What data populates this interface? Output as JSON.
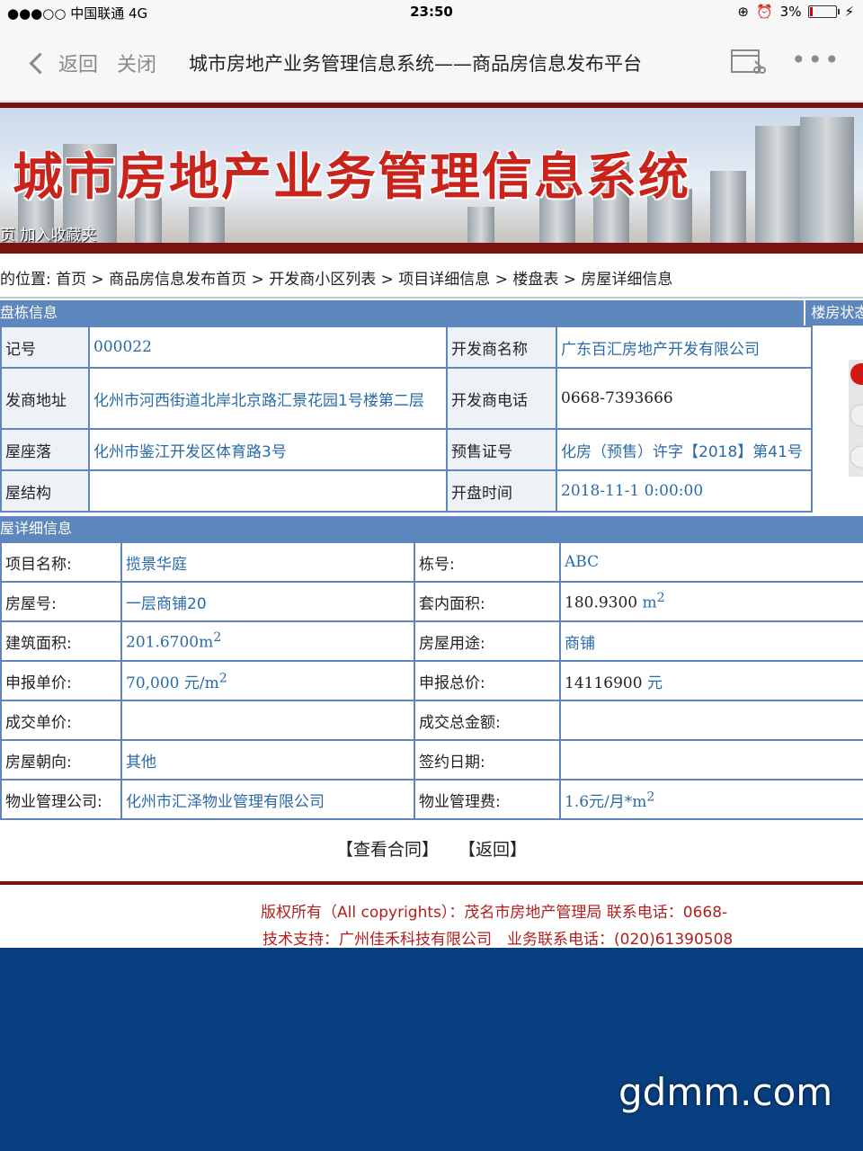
{
  "status": {
    "carrier": "●●●○○ 中国联通  4G",
    "time": "23:50",
    "battery": "3%"
  },
  "nav": {
    "back": "返回",
    "close": "关闭",
    "title": "城市房地产业务管理信息系统——商品房信息发布平台"
  },
  "banner": {
    "title": "城市房地产业务管理信息系统",
    "links": "页 加入收藏夹"
  },
  "breadcrumb": "的位置: 首页 > 商品房信息发布首页 > 开发商小区列表 > 项目详细信息 > 楼盘表 > 房屋详细信息",
  "building": {
    "header": "盘栋信息",
    "status_header": "楼房状态",
    "rows": [
      {
        "l1": "记号",
        "v1": "000022",
        "l2": "开发商名称",
        "v2": "广东百汇房地产开发有限公司"
      },
      {
        "l1": "发商地址",
        "v1": "化州市河西街道北岸北京路汇景花园1号楼第二层",
        "l2": "开发商电话",
        "v2": "0668-7393666"
      },
      {
        "l1": "屋座落",
        "v1": "化州市鉴江开发区体育路3号",
        "l2": "预售证号",
        "v2": "化房（预售）许字【2018】第41号"
      },
      {
        "l1": "屋结构",
        "v1": "",
        "l2": "开盘时间",
        "v2": "2018-11-1 0:00:00"
      }
    ]
  },
  "house": {
    "header": "屋详细信息",
    "rows": [
      {
        "l1": "项目名称:",
        "v1": "揽景华庭",
        "l2": "栋号:",
        "v2": "ABC",
        "sup1": "",
        "sup2": ""
      },
      {
        "l1": "房屋号:",
        "v1": "一层商铺20",
        "l2": "套内面积:",
        "v2": "180.9300",
        "u2": "m",
        "sup2": "2"
      },
      {
        "l1": "建筑面积:",
        "v1": "201.6700m",
        "sup1": "2",
        "l2": "房屋用途:",
        "v2": "商铺"
      },
      {
        "l1": "申报单价:",
        "v1": "70,000 元/m",
        "sup1": "2",
        "l2": "申报总价:",
        "v2": "14116900",
        "u2": "元"
      },
      {
        "l1": "成交单价:",
        "v1": "",
        "l2": "成交总金额:",
        "v2": ""
      },
      {
        "l1": "房屋朝向:",
        "v1": "其他",
        "l2": "签约日期:",
        "v2": ""
      },
      {
        "l1": "物业管理公司:",
        "v1": "化州市汇泽物业管理有限公司",
        "l2": "物业管理费:",
        "v2": "1.6元/月*m",
        "sup2": "2"
      }
    ]
  },
  "buttons": {
    "contract": "【查看合同】",
    "back": "【返回】"
  },
  "footer": {
    "line1": "版权所有（All copyrights）：茂名市房地产管理局 联系电话：0668-",
    "line2": "技术支持：广州佳禾科技有限公司　业务联系电话：(020)61390508"
  },
  "watermark": "gdmm.com"
}
